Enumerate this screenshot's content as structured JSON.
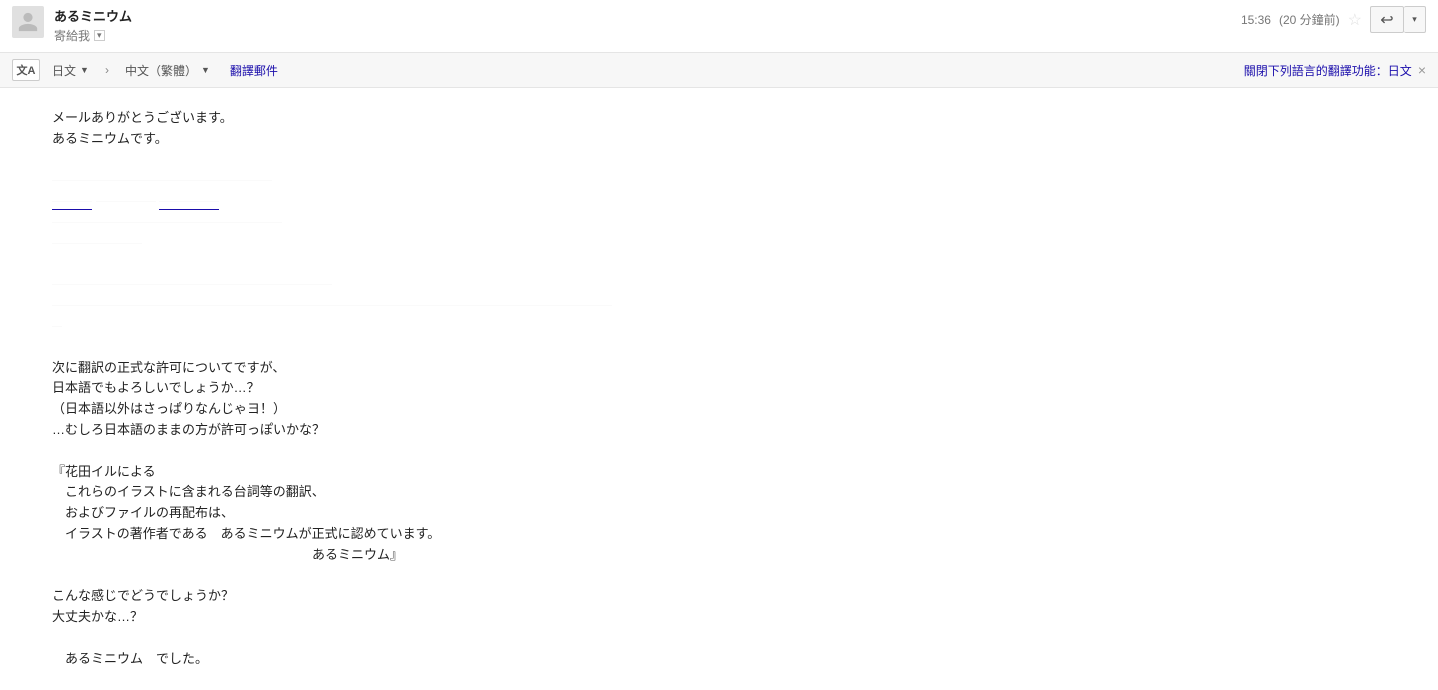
{
  "header": {
    "sender_name": "あるミニウム",
    "recipient_line_prefix": "寄給 ",
    "recipient_me": "我",
    "time": "15:36",
    "time_relative": "(20 分鐘前)"
  },
  "translate_bar": {
    "icon_text": "文A",
    "source_lang": "日文",
    "target_lang": "中文（繁體）",
    "translate_label": "翻譯郵件",
    "disable_label_prefix": "關閉下列語言的翻譯功能：",
    "disable_lang": "日文"
  },
  "body": {
    "l1": "メールありがとうございます。",
    "l2": "あるミニウムです。",
    "l3": "次に翻訳の正式な許可についてですが、",
    "l4": "日本語でもよろしいでしょうか…？",
    "l5": "（日本語以外はさっぱりなんじゃヨ！）",
    "l6": "…むしろ日本語のままの方が許可っぽいかな？",
    "l7": "『花田イルによる",
    "l8": "これらのイラストに含まれる台詞等の翻訳、",
    "l9": "およびファイルの再配布は、",
    "l10": "イラストの著作者である　あるミニウムが正式に認めています。",
    "l11": "あるミニウム』",
    "l12": "こんな感じでどうでしょうか？",
    "l13": "大丈夫かな…？",
    "l14": "あるミニウム　でした。"
  }
}
